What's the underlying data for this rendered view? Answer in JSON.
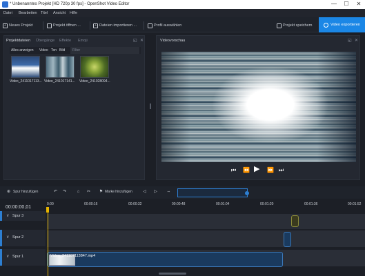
{
  "window": {
    "title": "* Unbenanntes Projekt [HD 720p 30 fps] - OpenShot Video Editor",
    "controls": [
      "—",
      "☐",
      "✕"
    ]
  },
  "menu": [
    "Datei",
    "Bearbeiten",
    "Titel",
    "Ansicht",
    "Hilfe"
  ],
  "toolbar": {
    "new_project": "Neues Projekt",
    "open_project": "Projekt öffnen ...",
    "import_files": "Dateien importieren ...",
    "choose_profile": "Profil auswählen",
    "save_project": "Projekt speichern",
    "export_video": "Video exportieren"
  },
  "left_panel": {
    "tabs": [
      "Projektdateien",
      "Übergänge",
      "Effekte",
      "Emoji"
    ],
    "filter_tabs": [
      "Alles anzeigen",
      "Video",
      "Ton",
      "Bild"
    ],
    "filter_placeholder": "Filter",
    "files": [
      {
        "name": "Video_2411017113..."
      },
      {
        "name": "Video_24101714​1..."
      },
      {
        "name": "Video_241028094..."
      }
    ]
  },
  "preview": {
    "title": "Videovorschau"
  },
  "timeline_toolbar": {
    "add_track": "Spur hinzufügen",
    "add_marker": "Marke hinzufügen"
  },
  "timecode": "00:00:00,01",
  "ruler_ticks": [
    "0:00",
    "00:00:16",
    "00:00:32",
    "00:00:48",
    "00:01:04",
    "00:01:20",
    "00:01:36",
    "00:01:52"
  ],
  "tracks": [
    {
      "label": "Spur 3"
    },
    {
      "label": "Spur 2"
    },
    {
      "label": "Spur 1"
    }
  ],
  "clips": {
    "main_clip_label": "Video_24110711​3847.mp4"
  },
  "colors": {
    "accent": "#1b87e6",
    "playhead": "#e6b400",
    "background": "#1c1f26"
  }
}
